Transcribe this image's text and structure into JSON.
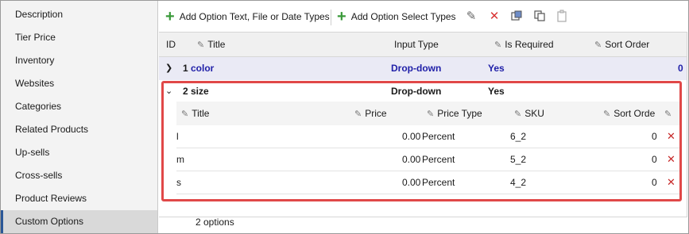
{
  "sidebar": {
    "items": [
      {
        "label": "Description"
      },
      {
        "label": "Tier Price"
      },
      {
        "label": "Inventory"
      },
      {
        "label": "Websites"
      },
      {
        "label": "Categories"
      },
      {
        "label": "Related Products"
      },
      {
        "label": "Up-sells"
      },
      {
        "label": "Cross-sells"
      },
      {
        "label": "Product Reviews"
      },
      {
        "label": "Custom Options"
      }
    ],
    "active": "Custom Options"
  },
  "toolbar": {
    "add_text_label": "Add Option Text, File or Date Types",
    "add_select_label": "Add Option Select Types",
    "icons": [
      "edit-icon",
      "delete-icon",
      "copy-icon",
      "duplicate-icon",
      "paste-icon"
    ]
  },
  "grid": {
    "columns": {
      "id": "ID",
      "title": "Title",
      "input_type": "Input Type",
      "is_required": "Is Required",
      "sort_order": "Sort Order"
    },
    "rows": [
      {
        "id": "1",
        "title": "color",
        "input_type": "Drop-down",
        "is_required": "Yes",
        "sort_order": "0"
      },
      {
        "id": "2",
        "title": "size",
        "input_type": "Drop-down",
        "is_required": "Yes",
        "sort_order": ""
      }
    ]
  },
  "detail": {
    "columns": {
      "title": "Title",
      "price": "Price",
      "price_type": "Price Type",
      "sku": "SKU",
      "sort_order": "Sort Orde"
    },
    "rows": [
      {
        "title": "l",
        "price": "0.00",
        "price_type": "Percent",
        "sku": "6_2",
        "sort_order": "0"
      },
      {
        "title": "m",
        "price": "0.00",
        "price_type": "Percent",
        "sku": "5_2",
        "sort_order": "0"
      },
      {
        "title": "s",
        "price": "0.00",
        "price_type": "Percent",
        "sku": "4_2",
        "sort_order": "0"
      }
    ]
  },
  "footer": {
    "count_label": "2 options"
  },
  "colors": {
    "accent": "#2b5797",
    "highlight": "#e04848",
    "link": "#1f1fa8",
    "add": "#3a9a3a",
    "delete": "#c62828"
  }
}
